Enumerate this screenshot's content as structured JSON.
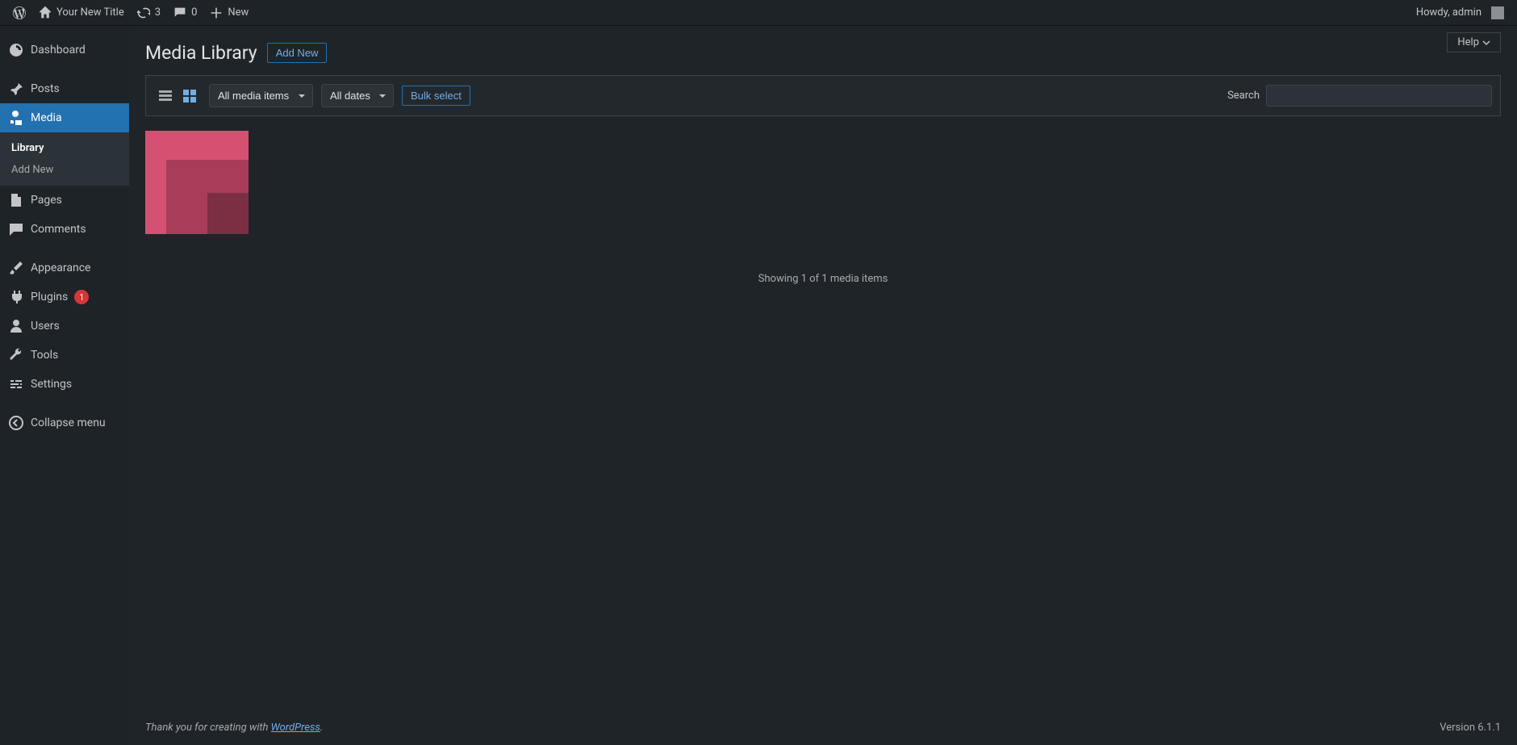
{
  "adminbar": {
    "site_title": "Your New Title",
    "updates_count": "3",
    "comments_count": "0",
    "new_label": "New",
    "howdy": "Howdy, admin"
  },
  "sidebar": {
    "dashboard": "Dashboard",
    "posts": "Posts",
    "media": "Media",
    "pages": "Pages",
    "comments": "Comments",
    "appearance": "Appearance",
    "plugins": "Plugins",
    "plugins_count": "1",
    "users": "Users",
    "tools": "Tools",
    "settings": "Settings",
    "collapse": "Collapse menu"
  },
  "submenu": {
    "library": "Library",
    "add_new": "Add New"
  },
  "page": {
    "title": "Media Library",
    "add_new": "Add New",
    "help": "Help"
  },
  "toolbar": {
    "filter_type": "All media items",
    "filter_date": "All dates",
    "bulk_select": "Bulk select",
    "search_label": "Search"
  },
  "status": "Showing 1 of 1 media items",
  "footer": {
    "thanks": "Thank you for creating with ",
    "wp": "WordPress",
    "period": ".",
    "version": "Version 6.1.1"
  }
}
